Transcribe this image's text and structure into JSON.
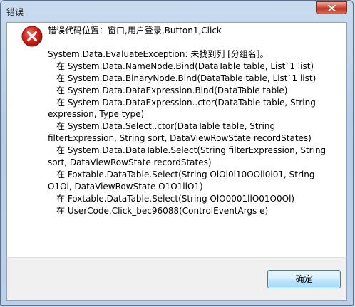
{
  "window": {
    "title": "错误"
  },
  "dialog": {
    "heading": "错误代码位置：窗口,用户登录,Button1,Click",
    "lines": [
      "System.Data.EvaluateException: 未找到列 [分组名]。",
      "在 System.Data.NameNode.Bind(DataTable table, List`1 list)",
      "在 System.Data.BinaryNode.Bind(DataTable table, List`1 list)",
      "在 System.Data.DataExpression.Bind(DataTable table)",
      "在 System.Data.DataExpression..ctor(DataTable table, String",
      "expression, Type type)",
      "在 System.Data.Select..ctor(DataTable table, String",
      "filterExpression, String sort, DataViewRowState recordStates)",
      "在 System.Data.DataTable.Select(String filterExpression, String",
      "sort, DataViewRowState recordStates)",
      "在 Foxtable.DataTable.Select(String OlOl0l10OOll0l01, String",
      "O1Ol, DataViewRowState O1O1llO1)",
      "在 Foxtable.DataTable.Select(String OlO0001llO01O0Ol)",
      "在 UserCode.Click_bec96088(ControlEventArgs e)"
    ]
  },
  "buttons": {
    "ok_label": "确定"
  },
  "icons": {
    "error": "error-icon",
    "close": "close-icon"
  },
  "colors": {
    "error_red": "#d8231c",
    "close_red": "#c8422c",
    "ok_border": "#3c7fb1"
  }
}
